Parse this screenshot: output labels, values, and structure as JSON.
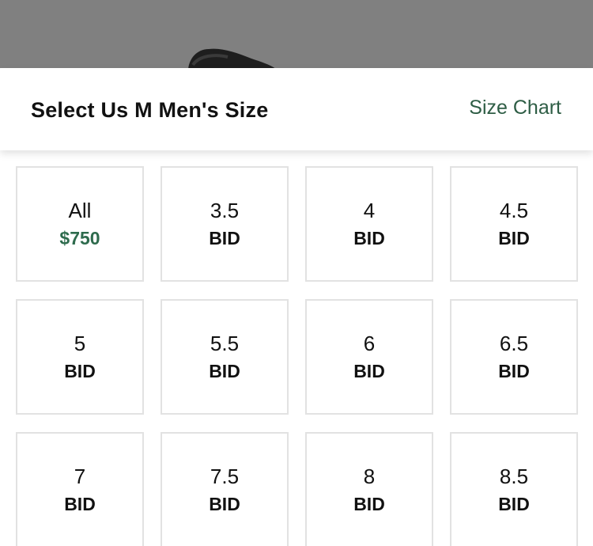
{
  "colors": {
    "accent": "#2e5d45",
    "price_highlight": "#2e6b4d",
    "backdrop": "#808080",
    "tile_border": "#e2e2e2"
  },
  "header": {
    "title": "Select Us M Men's Size",
    "size_chart_link": "Size Chart"
  },
  "sizes": [
    {
      "label": "All",
      "price": "$750",
      "highlight": true
    },
    {
      "label": "3.5",
      "price": "BID",
      "highlight": false
    },
    {
      "label": "4",
      "price": "BID",
      "highlight": false
    },
    {
      "label": "4.5",
      "price": "BID",
      "highlight": false
    },
    {
      "label": "5",
      "price": "BID",
      "highlight": false
    },
    {
      "label": "5.5",
      "price": "BID",
      "highlight": false
    },
    {
      "label": "6",
      "price": "BID",
      "highlight": false
    },
    {
      "label": "6.5",
      "price": "BID",
      "highlight": false
    },
    {
      "label": "7",
      "price": "BID",
      "highlight": false
    },
    {
      "label": "7.5",
      "price": "BID",
      "highlight": false
    },
    {
      "label": "8",
      "price": "BID",
      "highlight": false
    },
    {
      "label": "8.5",
      "price": "BID",
      "highlight": false
    }
  ]
}
